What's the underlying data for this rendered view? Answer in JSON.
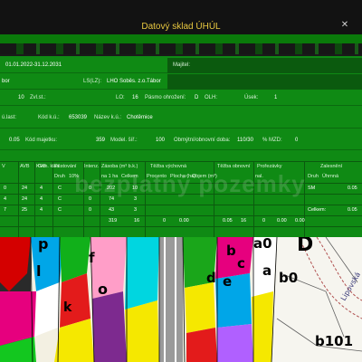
{
  "window": {
    "title": "Datový sklad ÚHÚL",
    "close_symbol": "✕"
  },
  "panel": {
    "period": "01.01.2022-31.12.2031",
    "owner_label": "Majitel:",
    "area_value": "bor",
    "ls_label": "LS(LZ):",
    "ls_value": "LHO Soběs. z.o.Tábor",
    "zvl_value": "10",
    "zvl_label": "Zvl.st.:",
    "lo_label": "LO:",
    "lo_value": "16",
    "pasmo_label": "Pásmo ohrožení:",
    "pasmo_value": "D",
    "olh_label": "OLH:",
    "usek_label": "Úsek:",
    "usek_value": "1",
    "uzast_label": "ú.last:",
    "kod_ku_label": "Kód k.ú.:",
    "kod_ku_value": "653039",
    "nazev_ku_label": "Název k.ú.:",
    "nazev_ku_value": "Chotěmice",
    "val_005": "0.05",
    "kod_majetku_label": "Kód majetku:",
    "kod_majetku_value": "359",
    "model_label": "Model. šíř.:",
    "model_value": "100",
    "obmyt_label": "Obmýtní/obnovní doba:",
    "obmyt_value": "110/30",
    "mzd_label": "% MZD:",
    "mzd_value": "0"
  },
  "table": {
    "headers": {
      "v": "V",
      "avb": "AVB",
      "kvb": "KVB",
      "gen_klas": "Gen. klas.",
      "pestovani": "Pěstování",
      "intenz": "Intenz.",
      "zasoba": "Zásoba (m³ b.k.)",
      "tezba_vychovna": "Těžba výchovná",
      "tezba_obnovni": "Těžba obnovní",
      "prorezavky": "Prořezávky",
      "zalesneni": "Zalesnění",
      "druh": "Druh",
      "proc": "10%",
      "na_1ha": "na 1 ha",
      "celkem": "Celkem",
      "procento": "Procento",
      "plocha_ha": "Plocha (ha)",
      "objem_m3": "Objem (m³)",
      "nal": "nal.",
      "urgence": "Úhrnná"
    },
    "rows": [
      {
        "v": "0",
        "avb": "24",
        "kvb": "4",
        "gen": "C",
        "v1": "0",
        "zas1": "202",
        "zas2": "10",
        "right1": "SM",
        "right2": "0.05"
      },
      {
        "v": "4",
        "avb": "24",
        "kvb": "4",
        "gen": "C",
        "v1": "0",
        "zas1": "74",
        "zas2": "3",
        "right1": "",
        "right2": ""
      },
      {
        "v": "7",
        "avb": "25",
        "kvb": "4",
        "gen": "C",
        "v1": "0",
        "zas1": "43",
        "zas2": "3",
        "right1": "Celkem:",
        "right2": "0.05"
      }
    ],
    "totals": [
      "319",
      "16",
      "0",
      "0.00",
      "0.05",
      "16",
      "0",
      "0.00",
      "0.00"
    ]
  },
  "watermark": "bezplatný pozemky",
  "map": {
    "labels": [
      "p",
      "l",
      "o",
      "f",
      "d",
      "a0",
      "a",
      "b",
      "c",
      "e",
      "k",
      "D",
      "b0",
      "b101",
      "Lipovská"
    ]
  },
  "colors": {
    "panel_green": "#0f8a14",
    "title_yellow": "#e8c840",
    "bg_dark": "#121212"
  }
}
